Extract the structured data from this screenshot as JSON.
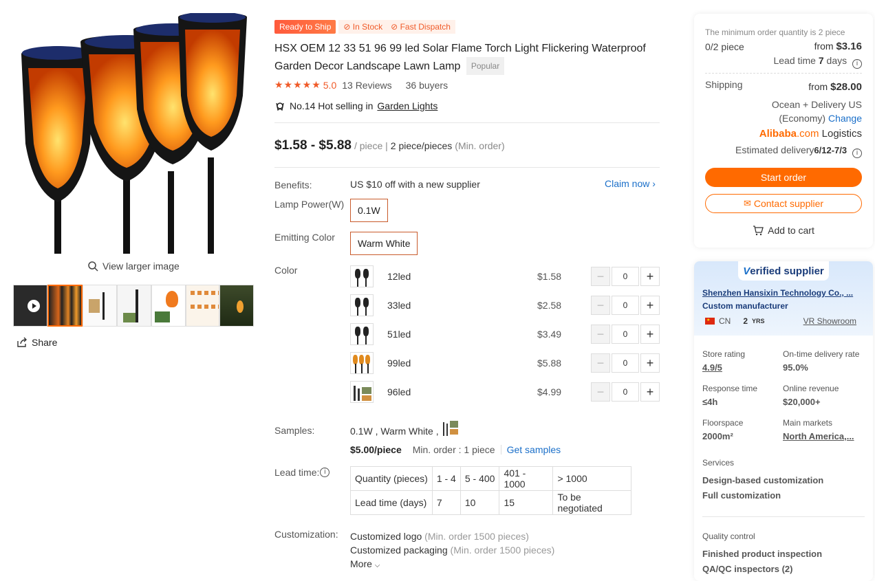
{
  "gallery": {
    "view_larger": "View larger image",
    "share": "Share"
  },
  "product": {
    "badge_ready": "Ready to Ship",
    "badge_in_stock": "In Stock",
    "badge_fast": "Fast Dispatch",
    "title": "HSX OEM 12 33 51 96 99 led Solar Flame Torch Light Flickering Waterproof Garden Decor Landscape Lawn Lamp",
    "tag_popular": "Popular",
    "stars": "★★★★★",
    "rating": "5.0",
    "reviews": "13 Reviews",
    "buyers": "36 buyers",
    "hot_prefix": "No.14 Hot selling in",
    "hot_category": "Garden Lights",
    "price_range": "$1.58 - $5.88",
    "price_unit": "/ piece |",
    "min_order_qty": "2 piece/pieces",
    "min_order_label": "(Min. order)"
  },
  "benefits": {
    "label": "Benefits:",
    "text": "US $10 off with a new supplier",
    "claim": "Claim now ›"
  },
  "lamp_power": {
    "label": "Lamp Power(W)",
    "option": "0.1W"
  },
  "emitting_color": {
    "label": "Emitting Color",
    "option": "Warm White"
  },
  "color": {
    "label": "Color",
    "variants": [
      {
        "name": "12led",
        "price": "$1.58",
        "qty": "0"
      },
      {
        "name": "33led",
        "price": "$2.58",
        "qty": "0"
      },
      {
        "name": "51led",
        "price": "$3.49",
        "qty": "0"
      },
      {
        "name": "99led",
        "price": "$5.88",
        "qty": "0"
      },
      {
        "name": "96led",
        "price": "$4.99",
        "qty": "0"
      }
    ],
    "minus": "−",
    "plus": "+"
  },
  "samples": {
    "label": "Samples:",
    "desc": "0.1W , Warm White ,",
    "price": "$5.00/piece",
    "min_order": "Min. order : 1 piece",
    "get_samples": "Get samples"
  },
  "lead_time": {
    "label": "Lead time:",
    "header": [
      "Quantity (pieces)",
      "1 - 4",
      "5 - 400",
      "401 - 1000",
      "> 1000"
    ],
    "row": [
      "Lead time (days)",
      "7",
      "10",
      "15",
      "To be negotiated"
    ]
  },
  "customization": {
    "label": "Customization:",
    "logo": "Customized logo",
    "logo_min": "(Min. order 1500 pieces)",
    "packaging": "Customized packaging",
    "packaging_min": "(Min. order 1500 pieces)",
    "more": "More"
  },
  "order": {
    "min_qty_note": "The minimum order quantity is 2 piece",
    "pieces": "0/2 piece",
    "from": "from",
    "from_price": "$3.16",
    "lead_prefix": "Lead time",
    "lead_days": "7",
    "lead_suffix": "days",
    "shipping_label": "Shipping",
    "shipping_price": "$28.00",
    "shipping_method_1": "Ocean + Delivery US",
    "shipping_method_2": "(Economy)",
    "change": "Change",
    "alibaba_brand": "Alibaba",
    "alibaba_com": ".com",
    "logistics": "Logistics",
    "est_delivery_label": "Estimated delivery",
    "est_delivery_date": "6/12-7/3",
    "start_order": "Start order",
    "contact_supplier": "Contact supplier",
    "add_to_cart": "Add to cart"
  },
  "supplier": {
    "verified_v": "V",
    "verified_rest": "erified supplier",
    "name": "Shenzhen Hansixin Technology Co., ...",
    "type": "Custom manufacturer",
    "country": "CN",
    "years_num": "2",
    "years_unit": "YRS",
    "vr": "VR Showroom",
    "stats": [
      {
        "label": "Store rating",
        "value": "4.9/5"
      },
      {
        "label": "On-time delivery rate",
        "value": "95.0%"
      },
      {
        "label": "Response time",
        "value": "≤4h"
      },
      {
        "label": "Online revenue",
        "value": "$20,000+"
      },
      {
        "label": "Floorspace",
        "value": "2000m²"
      },
      {
        "label": "Main markets",
        "value": "North America,..."
      }
    ],
    "services_label": "Services",
    "services": [
      "Design-based customization",
      "Full customization"
    ],
    "qc_label": "Quality control",
    "qc": [
      "Finished product inspection",
      "QA/QC inspectors (2)"
    ]
  },
  "colors": {
    "accent": "#ff6a00",
    "link": "#1a6fc9",
    "star": "#f05a28"
  }
}
